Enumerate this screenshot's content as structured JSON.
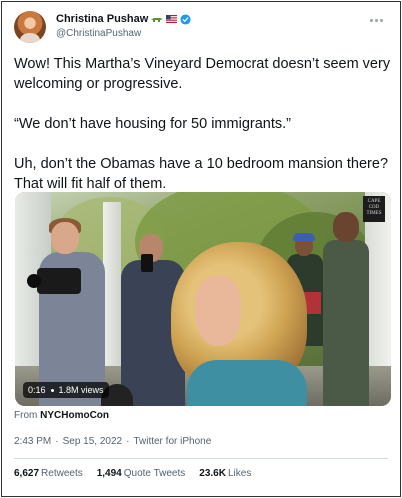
{
  "author": {
    "display_name": "Christina Pushaw",
    "handle": "@ChristinaPushaw",
    "badges": [
      "crocodile-emoji",
      "us-flag-emoji",
      "verified-badge"
    ]
  },
  "tweet": {
    "text": "Wow! This Martha’s Vineyard Democrat doesn’t seem very welcoming or progressive.\n\n“We don’t have housing for 50 immigrants.”\n\nUh, don’t the Obamas have a 10 bedroom mansion there? That will fit half of them."
  },
  "video": {
    "duration": "0:16",
    "views": "1.8M views",
    "watermark": "CAPE COD TIMES"
  },
  "source": {
    "prefix": "From",
    "account": "NYCHomoCon"
  },
  "meta": {
    "time": "2:43 PM",
    "separator": "·",
    "date": "Sep 15, 2022",
    "client": "Twitter for iPhone"
  },
  "stats": {
    "retweets_count": "6,627",
    "retweets_label": "Retweets",
    "quotes_count": "1,494",
    "quotes_label": "Quote Tweets",
    "likes_count": "23.6K",
    "likes_label": "Likes"
  },
  "colors": {
    "text_primary": "#0f1419",
    "text_secondary": "#536471",
    "verified_blue": "#1d9bf0",
    "border": "#2f3336"
  }
}
